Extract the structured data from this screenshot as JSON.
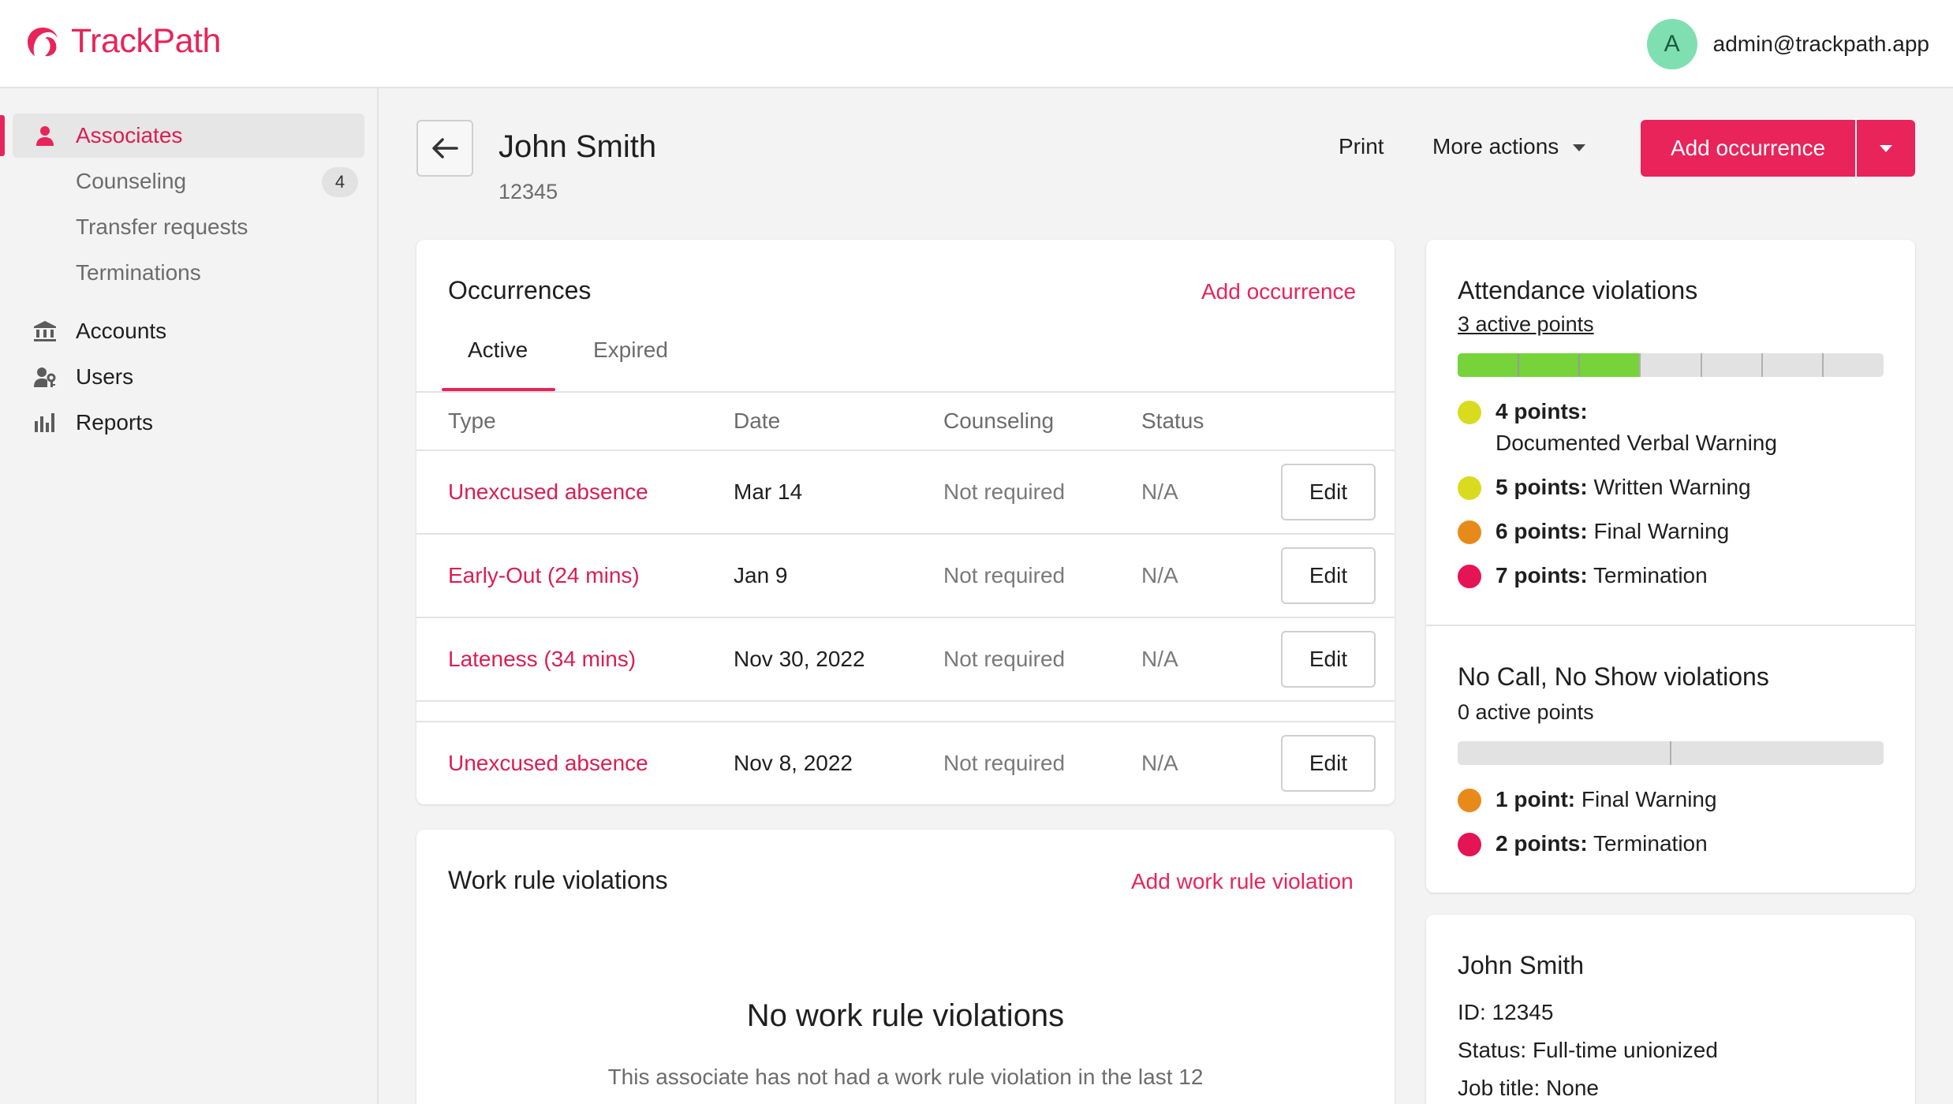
{
  "app": {
    "name": "TrackPath",
    "brand_color": "#e8245a"
  },
  "user": {
    "initial": "A",
    "email": "admin@trackpath.app"
  },
  "sidebar": {
    "items": [
      {
        "label": "Associates",
        "icon": "person-icon",
        "active": true
      },
      {
        "label": "Counseling",
        "badge": "4"
      },
      {
        "label": "Transfer requests"
      },
      {
        "label": "Terminations"
      },
      {
        "label": "Accounts",
        "icon": "bank-icon"
      },
      {
        "label": "Users",
        "icon": "users-key-icon"
      },
      {
        "label": "Reports",
        "icon": "bar-chart-icon"
      }
    ]
  },
  "page": {
    "title": "John Smith",
    "subtitle": "12345",
    "actions": {
      "print": "Print",
      "more": "More actions",
      "primary": "Add occurrence"
    }
  },
  "occurrences": {
    "title": "Occurrences",
    "add_link": "Add occurrence",
    "tabs": [
      {
        "label": "Active",
        "active": true
      },
      {
        "label": "Expired"
      }
    ],
    "columns": [
      "Type",
      "Date",
      "Counseling",
      "Status"
    ],
    "rows": [
      {
        "type": "Unexcused absence",
        "date": "Mar 14",
        "counseling": "Not required",
        "status": "N/A",
        "action": "Edit"
      },
      {
        "type": "Early-Out (24 mins)",
        "date": "Jan 9",
        "counseling": "Not required",
        "status": "N/A",
        "action": "Edit"
      },
      {
        "type": "Lateness (34 mins)",
        "date": "Nov 30, 2022",
        "counseling": "Not required",
        "status": "N/A",
        "action": "Edit"
      },
      {
        "type": "Unexcused absence",
        "date": "Nov 8, 2022",
        "counseling": "Not required",
        "status": "N/A",
        "action": "Edit"
      }
    ]
  },
  "work_rules": {
    "title": "Work rule violations",
    "add_link": "Add work rule violation",
    "empty_title": "No work rule violations",
    "empty_text": "This associate has not had a work rule violation in the last 12"
  },
  "attendance": {
    "title": "Attendance violations",
    "points_label": "3 active points",
    "active_points": 3,
    "max_points": 7,
    "legend": [
      {
        "points": "4 points:",
        "label": "Documented Verbal Warning",
        "color": "#d9db1f"
      },
      {
        "points": "5 points:",
        "label": "Written Warning",
        "color": "#d9db1f"
      },
      {
        "points": "6 points:",
        "label": "Final Warning",
        "color": "#e88a1a"
      },
      {
        "points": "7 points:",
        "label": "Termination",
        "color": "#e41455"
      }
    ]
  },
  "no_call": {
    "title": "No Call, No Show violations",
    "points_label": "0 active points",
    "active_points": 0,
    "max_points": 2,
    "legend": [
      {
        "points": "1 point:",
        "label": "Final Warning",
        "color": "#e88a1a"
      },
      {
        "points": "2 points:",
        "label": "Termination",
        "color": "#e41455"
      }
    ]
  },
  "associate_info": {
    "name": "John Smith",
    "id": "ID: 12345",
    "status": "Status: Full-time unionized",
    "job_title": "Job title: None"
  }
}
